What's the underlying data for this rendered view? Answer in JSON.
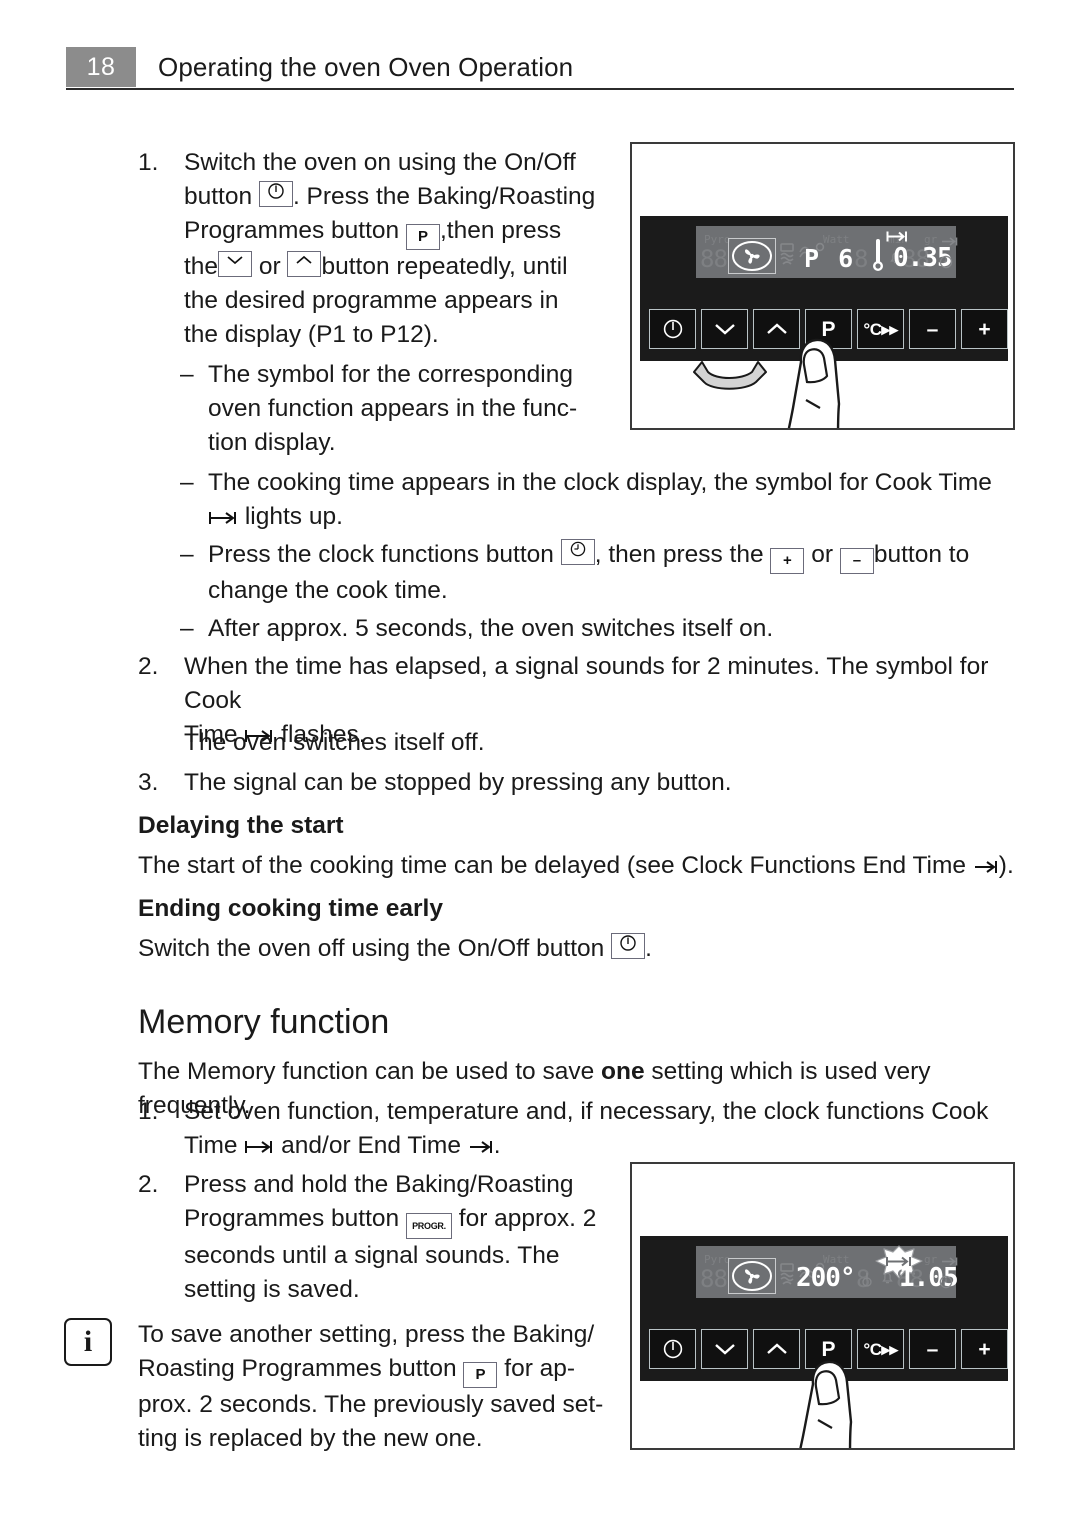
{
  "header": {
    "page_number": "18",
    "title": "Operating the oven Oven Operation"
  },
  "section_oven_programmes": {
    "steps": [
      {
        "num": "1.",
        "parts": [
          "Switch the oven on using the On/Off button ",
          " . Press the Baking/Roasting Programmes button ",
          " ,then press the ",
          " or ",
          " button repeatedly, until the desired programme appears in the display (P1 to P12)."
        ],
        "text_plain": "Switch the oven on using the On/Off button . Press the Baking/Roasting Programmes button ,then press the or button repeatedly, until the desired programme appears in the display (P1 to P12)."
      },
      {
        "num": "2.",
        "text_plain": "When the time has elapsed, a signal sounds for 2 minutes. The symbol for Cook Time  flashes."
      },
      {
        "num": "",
        "text_plain": "The oven switches itself off."
      },
      {
        "num": "3.",
        "text_plain": "The signal can be stopped by pressing any button."
      }
    ],
    "bullets": [
      {
        "bullet": "–",
        "text_plain": "The symbol for the corresponding oven function appears in the func-tion display."
      },
      {
        "bullet": "–",
        "text_plain": "The cooking time appears in the clock display, the symbol for Cook Time  lights up."
      },
      {
        "bullet": "–",
        "text_plain": "Press the clock functions button  , then press the  or  button to change the cook time."
      },
      {
        "bullet": "–",
        "text_plain": "After approx. 5 seconds, the oven switches itself on."
      }
    ],
    "step1_line1": "Switch the oven on using the On/Off",
    "step1_line2_a": "button",
    "step1_line2_b": ". Press the Baking/Roasting",
    "step1_line3_a": "Programmes button",
    "step1_line3_b": ",then press",
    "step1_line4_a": "the",
    "step1_line4_b": "or",
    "step1_line4_c": "button repeatedly, until",
    "step1_line5": "the desired programme appears in",
    "step1_line6": "the display (P1 to P12).",
    "b1_line1": "The symbol for the corresponding",
    "b1_line2": "oven function appears in the func-",
    "b1_line3": "tion display.",
    "b2_line1": "The cooking time appears in the clock display, the symbol for Cook Time",
    "b2_line2": "lights up.",
    "b3_line1_a": "Press the clock functions button",
    "b3_line1_b": ", then press the",
    "b3_line1_c": "or",
    "b3_line1_d": "button to",
    "b3_line2": "change the cook time.",
    "b4_line1": "After approx. 5 seconds, the oven switches itself on.",
    "step2_line1": "When the time has elapsed, a signal sounds for 2 minutes. The symbol for Cook",
    "step2_line2_a": "Time",
    "step2_line2_b": "flashes.",
    "step2_extra": "The oven switches itself off.",
    "step3_line1": "The signal can be stopped by pressing any button."
  },
  "section_delaying": {
    "heading": "Delaying the start",
    "body_a": "The start of the cooking time can be delayed (see Clock Functions End Time",
    "body_b": ")."
  },
  "section_ending": {
    "heading": "Ending cooking time early",
    "body_a": "Switch the oven off using the On/Off button",
    "body_b": "."
  },
  "section_memory": {
    "heading": "Memory function",
    "intro_a": "The Memory function can be used to save ",
    "intro_bold": "one",
    "intro_b": " setting which is used very frequently.",
    "step1_num": "1.",
    "step1_line1": "Set oven function, temperature and, if necessary, the clock functions Cook",
    "step1_line2_a": "Time",
    "step1_line2_b": "and/or End Time",
    "step1_line2_c": ".",
    "step2_num": "2.",
    "step2_line1": "Press and hold the Baking/Roasting",
    "step2_line2_a": "Programmes button",
    "step2_line2_b": "for approx. 2",
    "step2_line3": "seconds until a signal sounds. The",
    "step2_line4": "setting is saved.",
    "note_line1": "To save another setting, press the Baking/",
    "note_line2_a": "Roasting Programmes button",
    "note_line2_b": "for ap-",
    "note_line3": "prox. 2 seconds. The previously saved set-",
    "note_line4": "ting is replaced by the new one.",
    "note_icon": "i"
  },
  "illustration_top": {
    "name": "oven-control-panel-programme",
    "lcd": {
      "label_pyro": "Pyro",
      "label_watt": "Watt",
      "label_min": "min",
      "label_gr": "gr",
      "function_value": "P 6",
      "clock_value": "0.35",
      "active_function_icon": "fan-icon",
      "cook_time_symbol": "|→|",
      "end_time_symbol": "→|",
      "thermometer_lit": "true",
      "ghost_function_value": "88",
      "ghost_clock_value": "88"
    },
    "buttons": [
      {
        "name": "on-off-button",
        "glyph": "power-icon",
        "label": ""
      },
      {
        "name": "programme-down-button",
        "glyph": "chevron-down-icon",
        "label": ""
      },
      {
        "name": "programme-up-button",
        "glyph": "chevron-up-icon",
        "label": ""
      },
      {
        "name": "programmes-button",
        "glyph": "text",
        "label": "P"
      },
      {
        "name": "temperature-button",
        "glyph": "text-small",
        "label": "°C▸▸"
      },
      {
        "name": "minus-button",
        "glyph": "text",
        "label": "–"
      },
      {
        "name": "plus-button",
        "glyph": "text",
        "label": "+"
      },
      {
        "name": "clock-functions-button",
        "glyph": "clock-icon",
        "label": ""
      }
    ],
    "gesture": "press-repeatedly-arrow"
  },
  "illustration_bottom": {
    "name": "oven-control-panel-memory",
    "lcd": {
      "label_pyro": "Pyro",
      "label_watt": "Watt",
      "label_min": "min",
      "label_gr": "gr",
      "function_value": "200°",
      "clock_value": "1.05",
      "active_function_icon": "fan-icon",
      "cook_time_symbol": "|→|",
      "cook_time_flashing": "true",
      "end_time_symbol": "→|",
      "ghost_function_value": "88",
      "ghost_clock_value": "88"
    },
    "buttons": [
      {
        "name": "on-off-button",
        "glyph": "power-icon",
        "label": ""
      },
      {
        "name": "programme-down-button",
        "glyph": "chevron-down-icon",
        "label": ""
      },
      {
        "name": "programme-up-button",
        "glyph": "chevron-up-icon",
        "label": ""
      },
      {
        "name": "programmes-button",
        "glyph": "text",
        "label": "P"
      },
      {
        "name": "temperature-button",
        "glyph": "text-small",
        "label": "°C▸▸"
      },
      {
        "name": "minus-button",
        "glyph": "text",
        "label": "–"
      },
      {
        "name": "plus-button",
        "glyph": "text",
        "label": "+"
      },
      {
        "name": "clock-functions-button",
        "glyph": "clock-icon",
        "label": ""
      }
    ],
    "gesture": "press-and-hold-finger"
  }
}
